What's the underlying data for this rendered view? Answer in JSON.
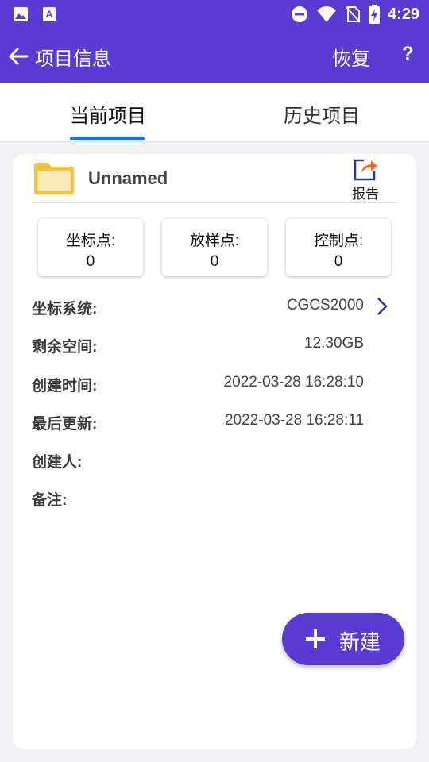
{
  "status_bar": {
    "time": "4:29",
    "colors": {
      "bar": "#5a3bd4"
    }
  },
  "app_bar": {
    "title": "项目信息",
    "restore_label": "恢复",
    "help_label": "?"
  },
  "tabs": [
    {
      "label": "当前项目",
      "active": true
    },
    {
      "label": "历史项目",
      "active": false
    }
  ],
  "project": {
    "name": "Unnamed",
    "report_label": "报告",
    "stats": [
      {
        "label": "坐标点:",
        "value": "0"
      },
      {
        "label": "放样点:",
        "value": "0"
      },
      {
        "label": "控制点:",
        "value": "0"
      }
    ],
    "info": [
      {
        "key": "坐标系统:",
        "value": "CGCS2000"
      },
      {
        "key": "剩余空间:",
        "value": "12.30GB"
      },
      {
        "key": "创建时间:",
        "value": "2022-03-28 16:28:10"
      },
      {
        "key": "最后更新:",
        "value": "2022-03-28 16:28:11"
      },
      {
        "key": "创建人:",
        "value": ""
      },
      {
        "key": "备注:",
        "value": ""
      }
    ]
  },
  "fab": {
    "label": "新建"
  },
  "colors": {
    "accent": "#5a3bd4",
    "tab_indicator": "#1a73e8",
    "folder": "#f5c33b",
    "report_arrow": "#f26b1d"
  }
}
